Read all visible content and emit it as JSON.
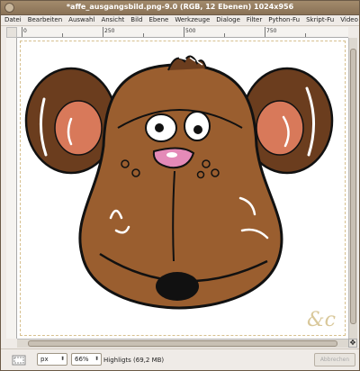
{
  "window": {
    "title": "*affe_ausgangsbild.png-9.0 (RGB, 12 Ebenen) 1024x956"
  },
  "menu": [
    "Datei",
    "Bearbeiten",
    "Auswahl",
    "Ansicht",
    "Bild",
    "Ebene",
    "Werkzeuge",
    "Dialoge",
    "Filter",
    "Python-Fu",
    "Skript-Fu",
    "Video"
  ],
  "ruler": {
    "labels": [
      "0",
      "250",
      "500",
      "750"
    ]
  },
  "statusbar": {
    "unit": "px",
    "zoom": "66%",
    "layer_info": "Highligts (69,2 MB)",
    "cancel_label": "Abbrechen"
  },
  "icons": {
    "window_menu": "window-menu-icon",
    "nav": "navigate-icon",
    "quickmask": "quickmask-icon",
    "dropdown": "chevron-down-icon"
  },
  "colors": {
    "fur": "#6b3d1e",
    "face": "#9a5e2f",
    "ear_inner": "#d8795a",
    "nose": "#e48ab8"
  }
}
